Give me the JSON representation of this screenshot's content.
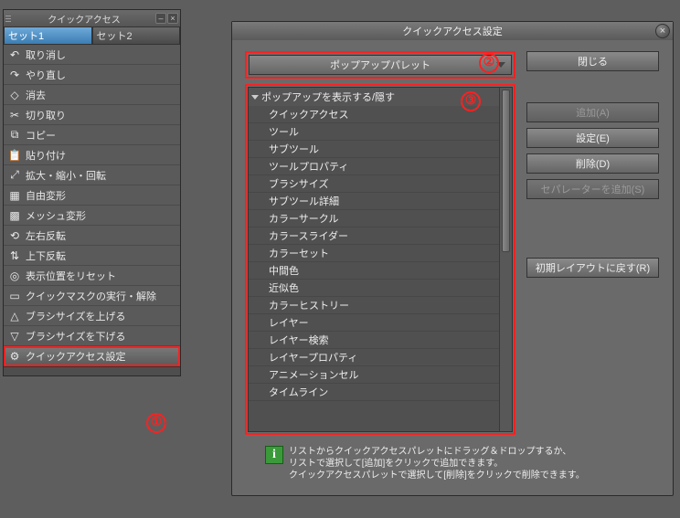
{
  "left_panel": {
    "title": "クイックアクセス",
    "tabs": [
      "セット1",
      "セット2"
    ],
    "items": [
      {
        "icon": "↶",
        "label": "取り消し"
      },
      {
        "icon": "↷",
        "label": "やり直し"
      },
      {
        "icon": "◇",
        "label": "消去"
      },
      {
        "icon": "✂",
        "label": "切り取り"
      },
      {
        "icon": "⧉",
        "label": "コピー"
      },
      {
        "icon": "📋",
        "label": "貼り付け"
      },
      {
        "icon": "⤢",
        "label": "拡大・縮小・回転"
      },
      {
        "icon": "▦",
        "label": "自由変形"
      },
      {
        "icon": "▩",
        "label": "メッシュ変形"
      },
      {
        "icon": "⟲",
        "label": "左右反転"
      },
      {
        "icon": "⇅",
        "label": "上下反転"
      },
      {
        "icon": "◎",
        "label": "表示位置をリセット"
      },
      {
        "icon": "▭",
        "label": "クイックマスクの実行・解除"
      },
      {
        "icon": "△",
        "label": "ブラシサイズを上げる"
      },
      {
        "icon": "▽",
        "label": "ブラシサイズを下げる"
      },
      {
        "icon": "⚙",
        "label": "クイックアクセス設定"
      }
    ],
    "selected_index": 15
  },
  "dialog": {
    "title": "クイックアクセス設定",
    "dropdown": "ポップアップパレット",
    "list_header": "ポップアップを表示する/隠す",
    "list_items": [
      "クイックアクセス",
      "ツール",
      "サブツール",
      "ツールプロパティ",
      "ブラシサイズ",
      "サブツール詳細",
      "カラーサークル",
      "カラースライダー",
      "カラーセット",
      "中間色",
      "近似色",
      "カラーヒストリー",
      "レイヤー",
      "レイヤー検索",
      "レイヤープロパティ",
      "アニメーションセル",
      "タイムライン"
    ],
    "buttons": {
      "close": "閉じる",
      "add": "追加(A)",
      "settings": "設定(E)",
      "delete": "削除(D)",
      "add_sep": "セパレーターを追加(S)",
      "reset": "初期レイアウトに戻す(R)"
    },
    "hint": {
      "line1": "リストからクイックアクセスパレットにドラッグ＆ドロップするか、",
      "line2": "リストで選択して[追加]をクリックで追加できます。",
      "line3": "クイックアクセスパレットで選択して[削除]をクリックで削除できます。"
    }
  },
  "marks": {
    "m1": "①",
    "m2": "②",
    "m3": "③"
  }
}
